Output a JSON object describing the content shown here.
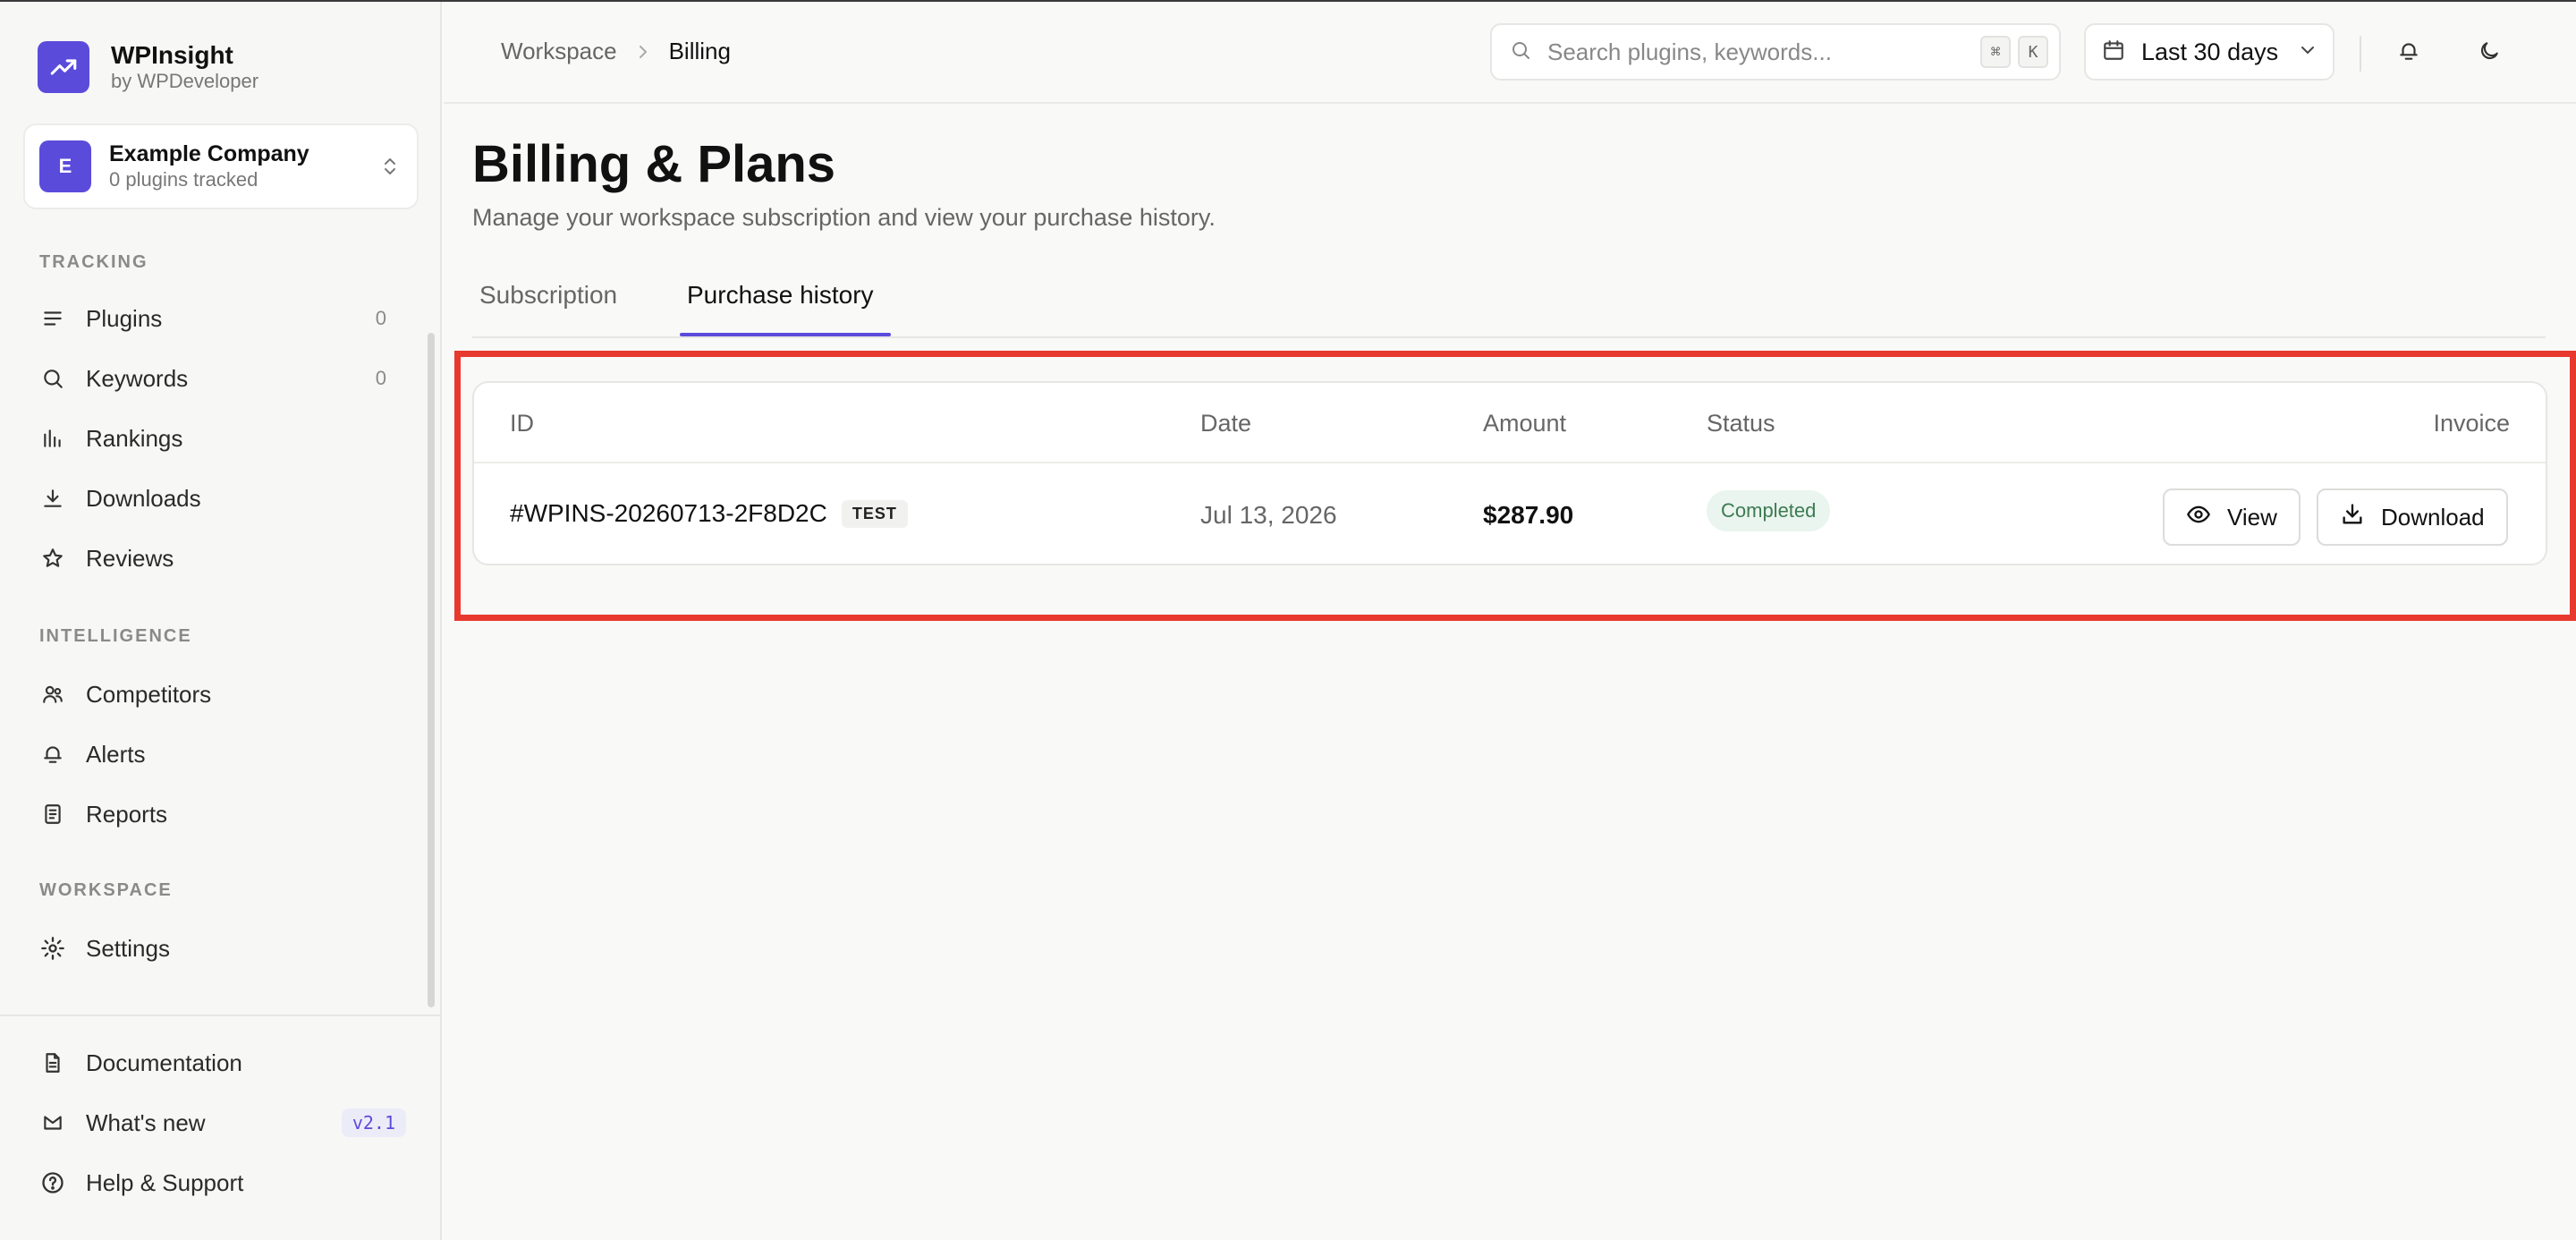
{
  "brand": {
    "name": "WPInsight",
    "sub": "by WPDeveloper"
  },
  "company": {
    "initial": "E",
    "name": "Example Company",
    "sub": "0 plugins tracked"
  },
  "sidebar": {
    "tracking_label": "TRACKING",
    "tracking": [
      {
        "label": "Plugins",
        "count": "0",
        "icon": "lines-icon"
      },
      {
        "label": "Keywords",
        "count": "0",
        "icon": "search-icon"
      },
      {
        "label": "Rankings",
        "count": "",
        "icon": "bar-chart-icon"
      },
      {
        "label": "Downloads",
        "count": "",
        "icon": "download-icon"
      },
      {
        "label": "Reviews",
        "count": "",
        "icon": "star-icon"
      }
    ],
    "intelligence_label": "INTELLIGENCE",
    "intelligence": [
      {
        "label": "Competitors",
        "icon": "users-icon"
      },
      {
        "label": "Alerts",
        "icon": "bell-icon"
      },
      {
        "label": "Reports",
        "icon": "document-icon"
      }
    ],
    "workspace_label": "WORKSPACE",
    "workspace": [
      {
        "label": "Settings",
        "icon": "gear-icon"
      }
    ],
    "footer": [
      {
        "label": "Documentation",
        "icon": "file-icon"
      },
      {
        "label": "What's new",
        "icon": "megaphone-icon",
        "badge": "v2.1"
      },
      {
        "label": "Help & Support",
        "icon": "help-icon"
      }
    ]
  },
  "header": {
    "breadcrumb": [
      "Workspace",
      "Billing"
    ],
    "search_placeholder": "Search plugins, keywords...",
    "kbd": [
      "⌘",
      "K"
    ],
    "date_range": "Last 30 days"
  },
  "page": {
    "title": "Billing & Plans",
    "subtitle": "Manage your workspace subscription and view your purchase history.",
    "tabs": [
      "Subscription",
      "Purchase history"
    ],
    "active_tab": 1
  },
  "table": {
    "headers": [
      "ID",
      "Date",
      "Amount",
      "Status",
      "Invoice"
    ],
    "rows": [
      {
        "id": "#WPINS-20260713-2F8D2C",
        "badge": "TEST",
        "date": "Jul 13, 2026",
        "amount": "$287.90",
        "status": "Completed",
        "view_label": "View",
        "download_label": "Download"
      }
    ]
  },
  "colors": {
    "accent": "#5b4bdb",
    "highlight": "#e8392f",
    "status_bg": "#e9f5ee",
    "status_text": "#3d7a52"
  }
}
